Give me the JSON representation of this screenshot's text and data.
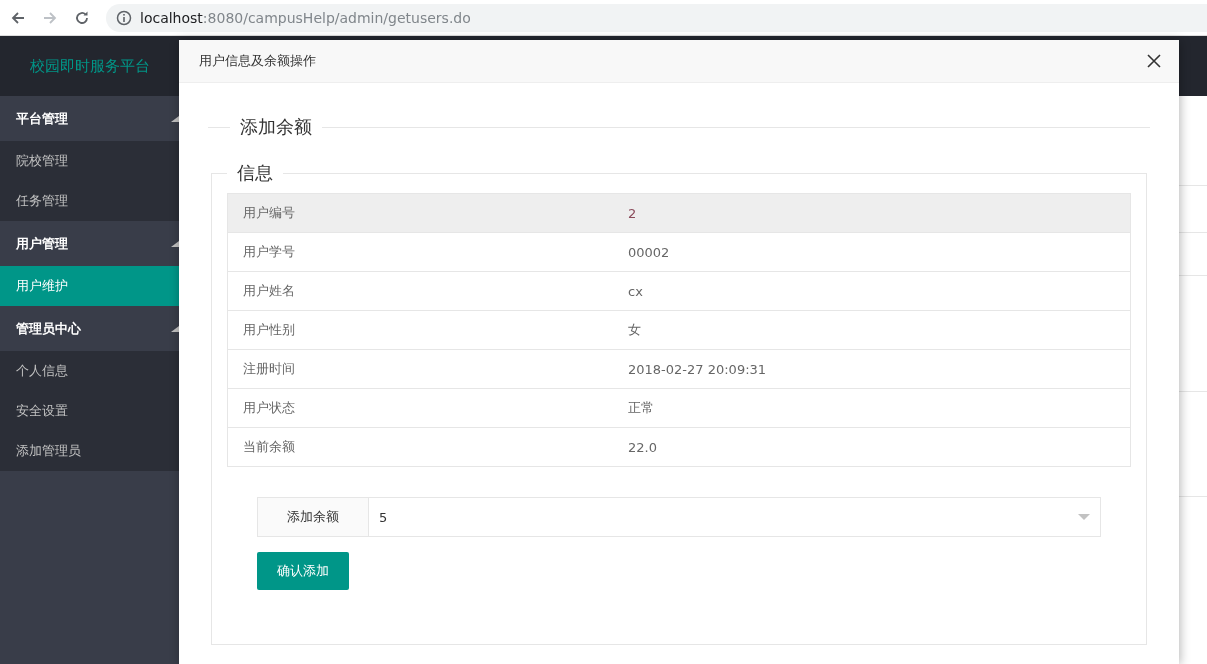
{
  "browser": {
    "url_host": "localhost",
    "url_path": ":8080/campusHelp/admin/getusers.do"
  },
  "header": {
    "logo": "校园即时服务平台"
  },
  "sidebar": {
    "groups": [
      {
        "label": "平台管理",
        "expanded": true,
        "items": [
          {
            "label": "院校管理",
            "selected": false
          },
          {
            "label": "任务管理",
            "selected": false
          }
        ]
      },
      {
        "label": "用户管理",
        "expanded": true,
        "items": [
          {
            "label": "用户维护",
            "selected": true
          }
        ]
      },
      {
        "label": "管理员中心",
        "expanded": true,
        "items": [
          {
            "label": "个人信息",
            "selected": false
          },
          {
            "label": "安全设置",
            "selected": false
          },
          {
            "label": "添加管理员",
            "selected": false
          }
        ]
      }
    ]
  },
  "modal": {
    "title": "用户信息及余额操作",
    "section_title": "添加余额",
    "info": {
      "legend": "信息",
      "rows": [
        {
          "label": "用户编号",
          "value": "2",
          "kind": "accent",
          "highlighted": true
        },
        {
          "label": "用户学号",
          "value": "00002",
          "kind": "plain",
          "highlighted": false
        },
        {
          "label": "用户姓名",
          "value": "cx",
          "kind": "plain",
          "highlighted": false
        },
        {
          "label": "用户性别",
          "value": "女",
          "kind": "plain",
          "highlighted": false
        },
        {
          "label": "注册时间",
          "value": "2018-02-27 20:09:31",
          "kind": "plain",
          "highlighted": false
        },
        {
          "label": "用户状态",
          "value": "正常",
          "kind": "plain",
          "highlighted": false
        },
        {
          "label": "当前余额",
          "value": "22.0",
          "kind": "plain",
          "highlighted": false
        }
      ]
    },
    "form": {
      "label": "添加余额",
      "value": "5"
    },
    "submit": "确认添加"
  }
}
